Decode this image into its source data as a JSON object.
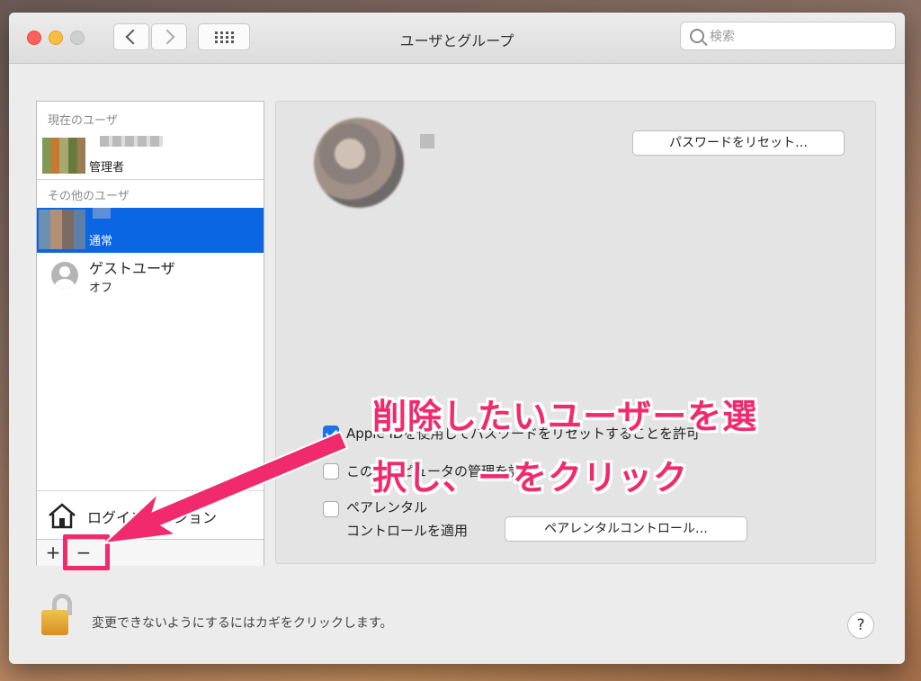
{
  "window": {
    "title": "ユーザとグループ",
    "search_placeholder": "検索"
  },
  "sidebar": {
    "current_users_label": "現在のユーザ",
    "current_user": {
      "role": "管理者"
    },
    "other_users_label": "その他のユーザ",
    "selected_user": {
      "role": "通常"
    },
    "guest_user": {
      "name": "ゲストユーザ",
      "status": "オフ"
    },
    "login_options_label": "ログインオプション",
    "add_label": "+",
    "remove_label": "−"
  },
  "detail": {
    "reset_password_label": "パスワードをリセット…",
    "checkbox_apple_id": {
      "label": "Apple IDを使用してパスワードをリセットすることを許可",
      "checked": true
    },
    "checkbox_admin": {
      "label": "このコンピュータの管理を許可",
      "checked": false
    },
    "checkbox_parental_line1": "ペアレンタル",
    "checkbox_parental_line2": "コントロールを適用",
    "parental_controls_label": "ペアレンタルコントロール…"
  },
  "footer": {
    "lock_text": "変更できないようにするにはカギをクリックします。",
    "help_label": "?"
  },
  "annotation": {
    "line1": "削除したいユーザーを選",
    "line2": "択し、ーをクリック",
    "color": "#f02a6c"
  },
  "colors": {
    "selection": "#0b66e4",
    "accent": "#f02a6c"
  }
}
